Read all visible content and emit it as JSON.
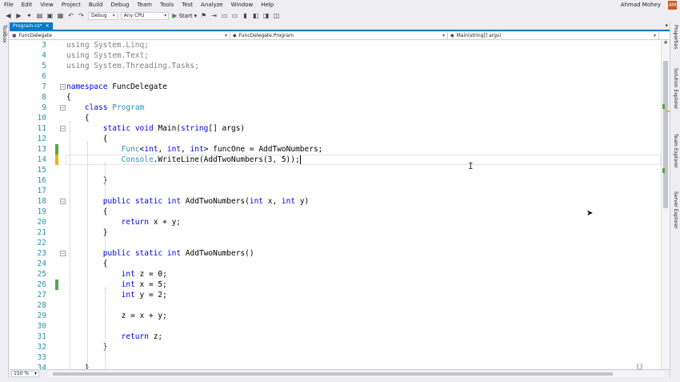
{
  "menubar": {
    "items": [
      "File",
      "Edit",
      "View",
      "Project",
      "Build",
      "Debug",
      "Team",
      "Tools",
      "Test",
      "Analyze",
      "Window",
      "Help"
    ],
    "user": "Ahmad Mohey",
    "avatar": "AM"
  },
  "toolbar": {
    "config": "Debug",
    "platform": "Any CPU",
    "start_label": "Start"
  },
  "side_panels": {
    "left": [
      "Toolbox"
    ],
    "right": [
      "Properties",
      "Solution Explorer",
      "Team Explorer",
      "Server Explorer"
    ]
  },
  "tab": {
    "label": "Program.cs*",
    "close": "✕"
  },
  "navbar": {
    "project": "FuncDelegate",
    "class": "FuncDelegate.Program",
    "member": "Main(string[] args)"
  },
  "code_lines": [
    {
      "n": "3",
      "t": "using System.Linq;"
    },
    {
      "n": "4",
      "t": "using System.Text;"
    },
    {
      "n": "5",
      "t": "using System.Threading.Tasks;"
    },
    {
      "n": "6",
      "t": ""
    },
    {
      "n": "7",
      "t": "namespace FuncDelegate"
    },
    {
      "n": "8",
      "t": "{"
    },
    {
      "n": "9",
      "t": "    class Program"
    },
    {
      "n": "10",
      "t": "    {"
    },
    {
      "n": "11",
      "t": "        static void Main(string[] args)"
    },
    {
      "n": "12",
      "t": "        {"
    },
    {
      "n": "13",
      "t": "            Func<int, int, int> funcOne = AddTwoNumbers;"
    },
    {
      "n": "14",
      "t": "            Console.WriteLine(AddTwoNumbers(3, 5));"
    },
    {
      "n": "15",
      "t": ""
    },
    {
      "n": "16",
      "t": "        }"
    },
    {
      "n": "17",
      "t": ""
    },
    {
      "n": "18",
      "t": "        public static int AddTwoNumbers(int x, int y)"
    },
    {
      "n": "19",
      "t": "        {"
    },
    {
      "n": "20",
      "t": "            return x + y;"
    },
    {
      "n": "21",
      "t": "        }"
    },
    {
      "n": "22",
      "t": ""
    },
    {
      "n": "23",
      "t": "        public static int AddTwoNumbers()"
    },
    {
      "n": "24",
      "t": "        {"
    },
    {
      "n": "25",
      "t": "            int z = 0;"
    },
    {
      "n": "26",
      "t": "            int x = 5;"
    },
    {
      "n": "27",
      "t": "            int y = 2;"
    },
    {
      "n": "28",
      "t": ""
    },
    {
      "n": "29",
      "t": "            z = x + y;"
    },
    {
      "n": "30",
      "t": ""
    },
    {
      "n": "31",
      "t": "            return z;"
    },
    {
      "n": "32",
      "t": "        }"
    },
    {
      "n": "33",
      "t": ""
    },
    {
      "n": "34",
      "t": "    }"
    }
  ],
  "status": {
    "zoom": "150 %"
  },
  "colors": {
    "keyword": "#0000ff",
    "type": "#2b91af",
    "saved_change": "#57a64a",
    "unsaved_change": "#e8b60f",
    "accent": "#007acc"
  }
}
